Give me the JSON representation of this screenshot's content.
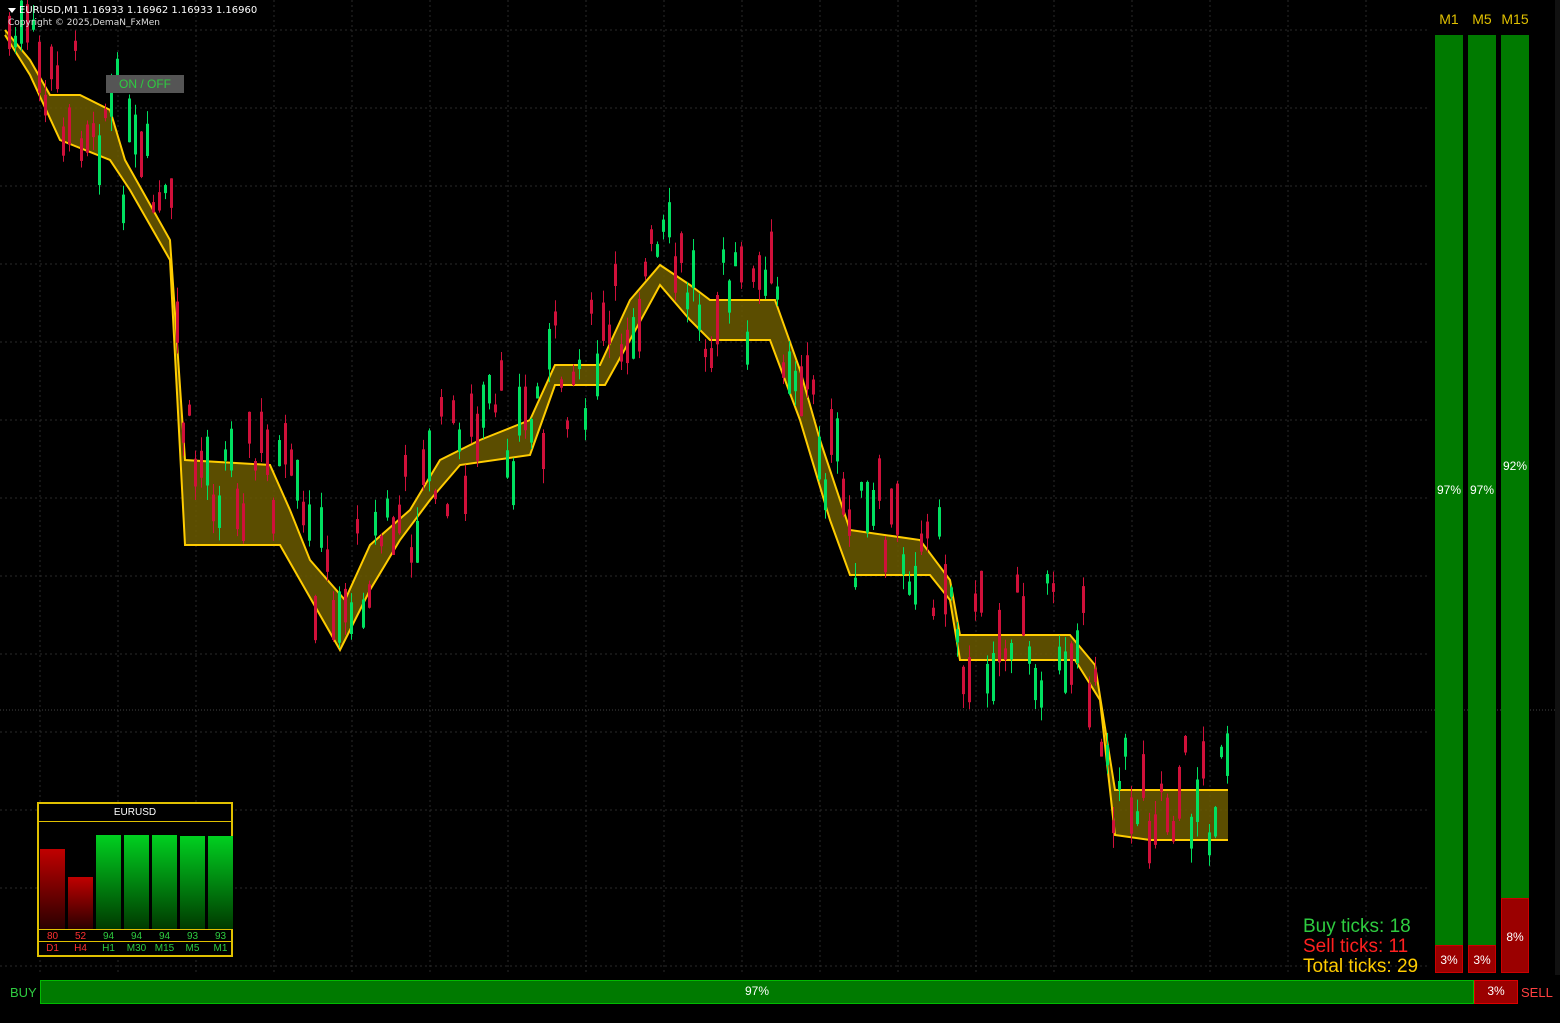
{
  "header": {
    "symbol_line": "EURUSD,M1  1.16933 1.16962 1.16933 1.16960",
    "copyright": "Copyright © 2025,DemaN_FxMen"
  },
  "toggle": {
    "label": "ON / OFF"
  },
  "timeframe_columns": [
    {
      "label": "M1",
      "buy_pct": "97%",
      "sell_pct": "3%",
      "buy_fraction": 0.97
    },
    {
      "label": "M5",
      "buy_pct": "97%",
      "sell_pct": "3%",
      "buy_fraction": 0.97
    },
    {
      "label": "M15",
      "buy_pct": "92%",
      "sell_pct": "8%",
      "buy_fraction": 0.92
    }
  ],
  "bottom_bar": {
    "buy_label": "BUY",
    "sell_label": "SELL",
    "buy_pct": "97%",
    "sell_pct": "3%",
    "buy_fraction": 0.97
  },
  "ticks": {
    "buy": "Buy ticks: 18",
    "sell": "Sell ticks: 11",
    "total": "Total ticks: 29"
  },
  "strength_panel": {
    "title": "EURUSD",
    "bars": [
      {
        "tf": "D1",
        "value": "80",
        "fraction": 0.8,
        "color": "red"
      },
      {
        "tf": "H4",
        "value": "52",
        "fraction": 0.52,
        "color": "red"
      },
      {
        "tf": "H1",
        "value": "94",
        "fraction": 0.94,
        "color": "green"
      },
      {
        "tf": "M30",
        "value": "94",
        "fraction": 0.94,
        "color": "green"
      },
      {
        "tf": "M15",
        "value": "94",
        "fraction": 0.94,
        "color": "green"
      },
      {
        "tf": "M5",
        "value": "93",
        "fraction": 0.93,
        "color": "green"
      },
      {
        "tf": "M1",
        "value": "93",
        "fraction": 0.93,
        "color": "green"
      }
    ]
  },
  "colors": {
    "bull": "#00e060",
    "bear": "#d0103a",
    "band_fill": "#6b5a00",
    "band_line": "#ffcc00",
    "buy_green": "#2ecc40",
    "sell_red": "#ff2020",
    "total_yellow": "#ffcc00"
  }
}
